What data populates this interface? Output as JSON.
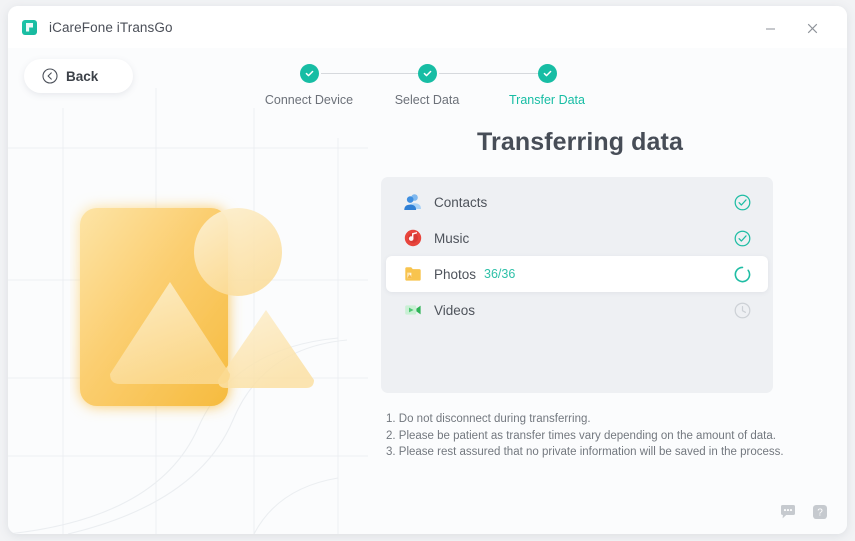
{
  "window": {
    "app_icon": "app-logo-icon",
    "title": "iCareFone iTransGo",
    "controls": {
      "minimize": "minimize-icon",
      "close": "close-icon"
    }
  },
  "back_button": {
    "label": "Back",
    "icon": "circle-arrow-left-icon"
  },
  "stepper": {
    "steps": [
      {
        "label": "Connect Device",
        "state": "done",
        "icon": "check-circle-icon"
      },
      {
        "label": "Select Data",
        "state": "done",
        "icon": "check-circle-icon"
      },
      {
        "label": "Transfer Data",
        "state": "active",
        "icon": "check-circle-icon"
      }
    ]
  },
  "main": {
    "title": "Transferring data",
    "transfer_items": [
      {
        "label": "Contacts",
        "count": "",
        "status": "completed",
        "icon": "contacts-icon",
        "status_icon": "check-circle-outline-icon"
      },
      {
        "label": "Music",
        "count": "",
        "status": "completed",
        "icon": "music-disc-icon",
        "status_icon": "check-circle-outline-icon"
      },
      {
        "label": "Photos",
        "count": "36/36",
        "status": "in-progress",
        "icon": "photos-folder-icon",
        "status_icon": "spinner-icon"
      },
      {
        "label": "Videos",
        "count": "",
        "status": "pending",
        "icon": "video-camera-icon",
        "status_icon": "clock-icon"
      }
    ],
    "notes": [
      "1. Do not disconnect during transferring.",
      "2. Please be patient as transfer times vary depending on the amount of data.",
      "3. Please rest assured that no private information will be saved in the process."
    ],
    "illustration": "photo-image-illustration"
  },
  "footer": {
    "feedback_icon": "chat-bubble-icon",
    "help_icon": "question-mark-icon"
  },
  "colors": {
    "accent_teal": "#17bda4",
    "count_teal": "#2fc0a8",
    "illustration_orange": "#f8c24a",
    "text_primary": "#474d57",
    "text_secondary": "#73787f",
    "panel_bg": "#eef0f3"
  }
}
